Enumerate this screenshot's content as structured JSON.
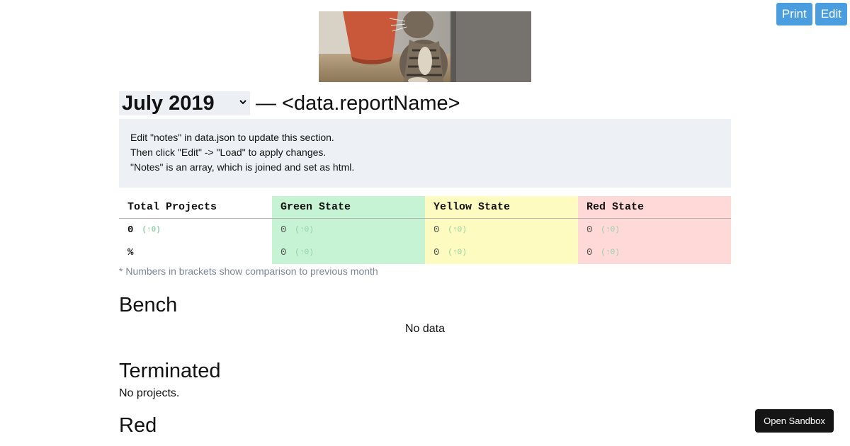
{
  "toolbar": {
    "print_label": "Print",
    "edit_label": "Edit"
  },
  "header": {
    "month_value": "July 2019",
    "title_suffix": "— <data.reportName>"
  },
  "notes": {
    "lines": [
      "Edit \"notes\" in data.json to update this section.",
      "Then click \"Edit\" -> \"Load\" to apply changes.",
      "\"Notes\" is an array, which is joined and set as html."
    ]
  },
  "stats": {
    "headers": [
      "Total Projects",
      "Green State",
      "Yellow State",
      "Red State"
    ],
    "rows": [
      {
        "values": [
          "0",
          "0",
          "0",
          "0"
        ],
        "deltas": [
          "(↑0)",
          "(↑0)",
          "(↑0)",
          "(↑0)"
        ]
      },
      {
        "values": [
          "%",
          "0",
          "0",
          "0"
        ],
        "deltas": [
          "",
          "(↑0)",
          "(↑0)",
          "(↑0)"
        ]
      }
    ],
    "footnote": "* Numbers in brackets show comparison to previous month"
  },
  "sections": {
    "bench_title": "Bench",
    "bench_empty": "No data",
    "terminated_title": "Terminated",
    "terminated_empty": "No projects.",
    "red_title": "Red"
  },
  "sandbox": {
    "label": "Open Sandbox"
  },
  "colors": {
    "button_blue": "#4a9ee0",
    "green_state": "#c6f3d3",
    "yellow_state": "#fdfbbf",
    "red_state": "#fed9d8",
    "notes_bg": "#edf1f5"
  }
}
